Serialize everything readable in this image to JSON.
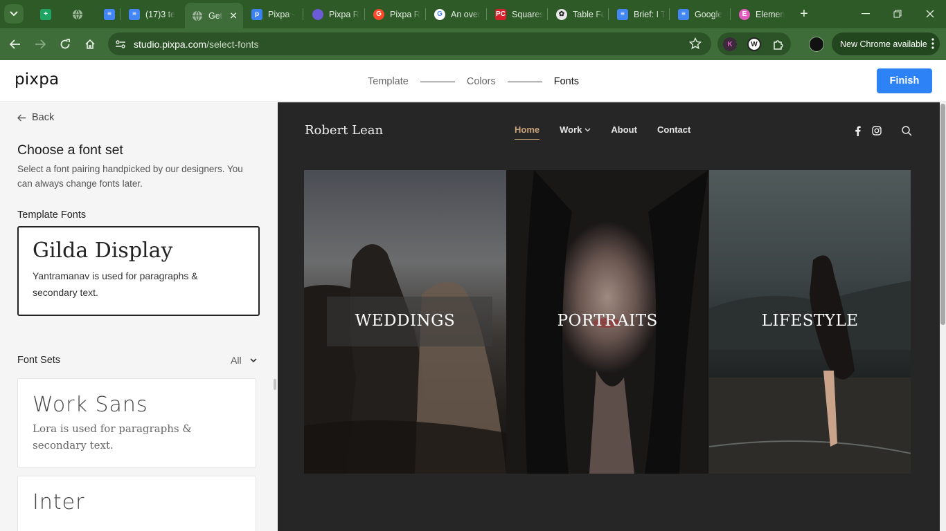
{
  "browser": {
    "tabs": [
      {
        "title": "",
        "favicon": "sheets-icon",
        "color": "#1fa463"
      },
      {
        "title": "",
        "favicon": "globe-icon",
        "color": "#9fb59c"
      },
      {
        "title": "",
        "favicon": "docs-icon",
        "color": "#4285f4"
      },
      {
        "title": "(17)3 te",
        "favicon": "docs-icon",
        "color": "#4285f4"
      },
      {
        "title": "Get",
        "favicon": "globe-icon",
        "color": "#9fb59c",
        "active": true
      },
      {
        "title": "Pixpa -",
        "favicon": "pixpa-icon",
        "color": "#3b82f6"
      },
      {
        "title": "Pixpa R",
        "favicon": "arc-icon",
        "color": "#6b5bd6"
      },
      {
        "title": "Pixpa R",
        "favicon": "g2-icon",
        "color": "#ff492c"
      },
      {
        "title": "An over",
        "favicon": "google-icon",
        "color": "#ffffff"
      },
      {
        "title": "Squares",
        "favicon": "pcmag-icon",
        "color": "#d6202b"
      },
      {
        "title": "Table Fo",
        "favicon": "openai-icon",
        "color": "#e8e8e8"
      },
      {
        "title": "Brief: I T",
        "favicon": "docs-icon",
        "color": "#4285f4"
      },
      {
        "title": "Google",
        "favicon": "docs-icon",
        "color": "#4285f4"
      },
      {
        "title": "Elemen",
        "favicon": "elementor-icon",
        "color": "#e35cc0"
      }
    ],
    "url_host": "studio.pixpa.com",
    "url_path": "/select-fonts",
    "update_label": "New Chrome available"
  },
  "header": {
    "logo": "pixpa",
    "steps": [
      "Template",
      "Colors",
      "Fonts"
    ],
    "finish_label": "Finish",
    "accent_color": "#2d83f6"
  },
  "sidebar": {
    "back_label": "Back",
    "title": "Choose a font set",
    "description": "Select a font pairing handpicked by our designers. You can always change fonts later.",
    "template_fonts_label": "Template Fonts",
    "selected_font": {
      "name": "Gilda Display",
      "description": "Yantramanav is used for paragraphs & secondary text."
    },
    "font_sets_label": "Font Sets",
    "filter_value": "All",
    "font_sets": [
      {
        "name": "Work Sans",
        "description": "Lora is used for paragraphs & secondary text."
      },
      {
        "name": "Inter",
        "description": ""
      }
    ]
  },
  "preview": {
    "site_name": "Robert Lean",
    "nav": [
      "Home",
      "Work",
      "About",
      "Contact"
    ],
    "nav_active_color": "#c9a47a",
    "gallery": [
      "WEDDINGS",
      "PORTRAITS",
      "LIFESTYLE"
    ]
  }
}
